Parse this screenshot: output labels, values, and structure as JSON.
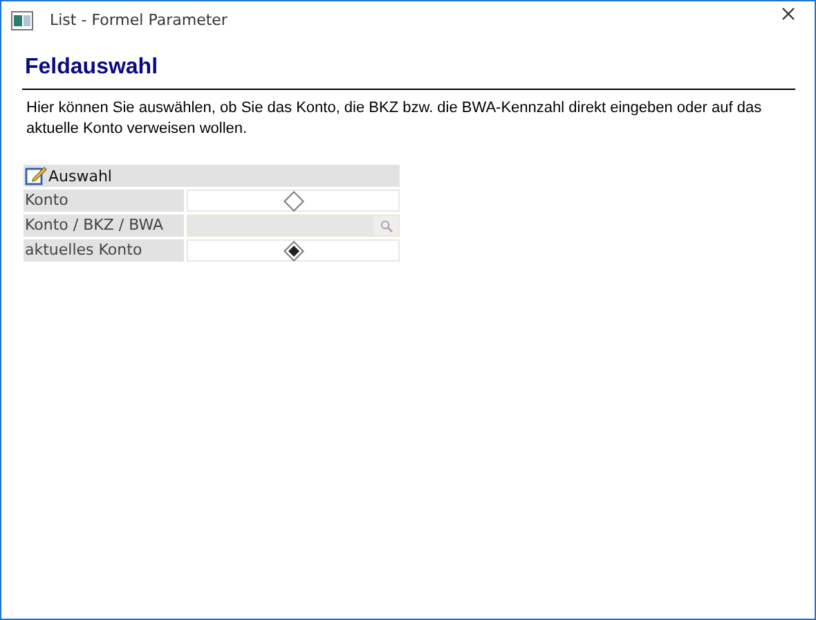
{
  "window": {
    "title": "List - Formel Parameter"
  },
  "heading": "Feldauswahl",
  "description": "Hier können Sie auswählen, ob Sie das Konto, die BKZ bzw. die BWA-Kennzahl direkt eingeben oder auf das aktuelle Konto verweisen wollen.",
  "section": {
    "title": "Auswahl",
    "rows": [
      {
        "label": "Konto",
        "kind": "radio",
        "selected": false
      },
      {
        "label": "Konto / BKZ / BWA",
        "kind": "lookup",
        "disabled": true
      },
      {
        "label": "aktuelles Konto",
        "kind": "radio",
        "selected": true
      }
    ]
  }
}
